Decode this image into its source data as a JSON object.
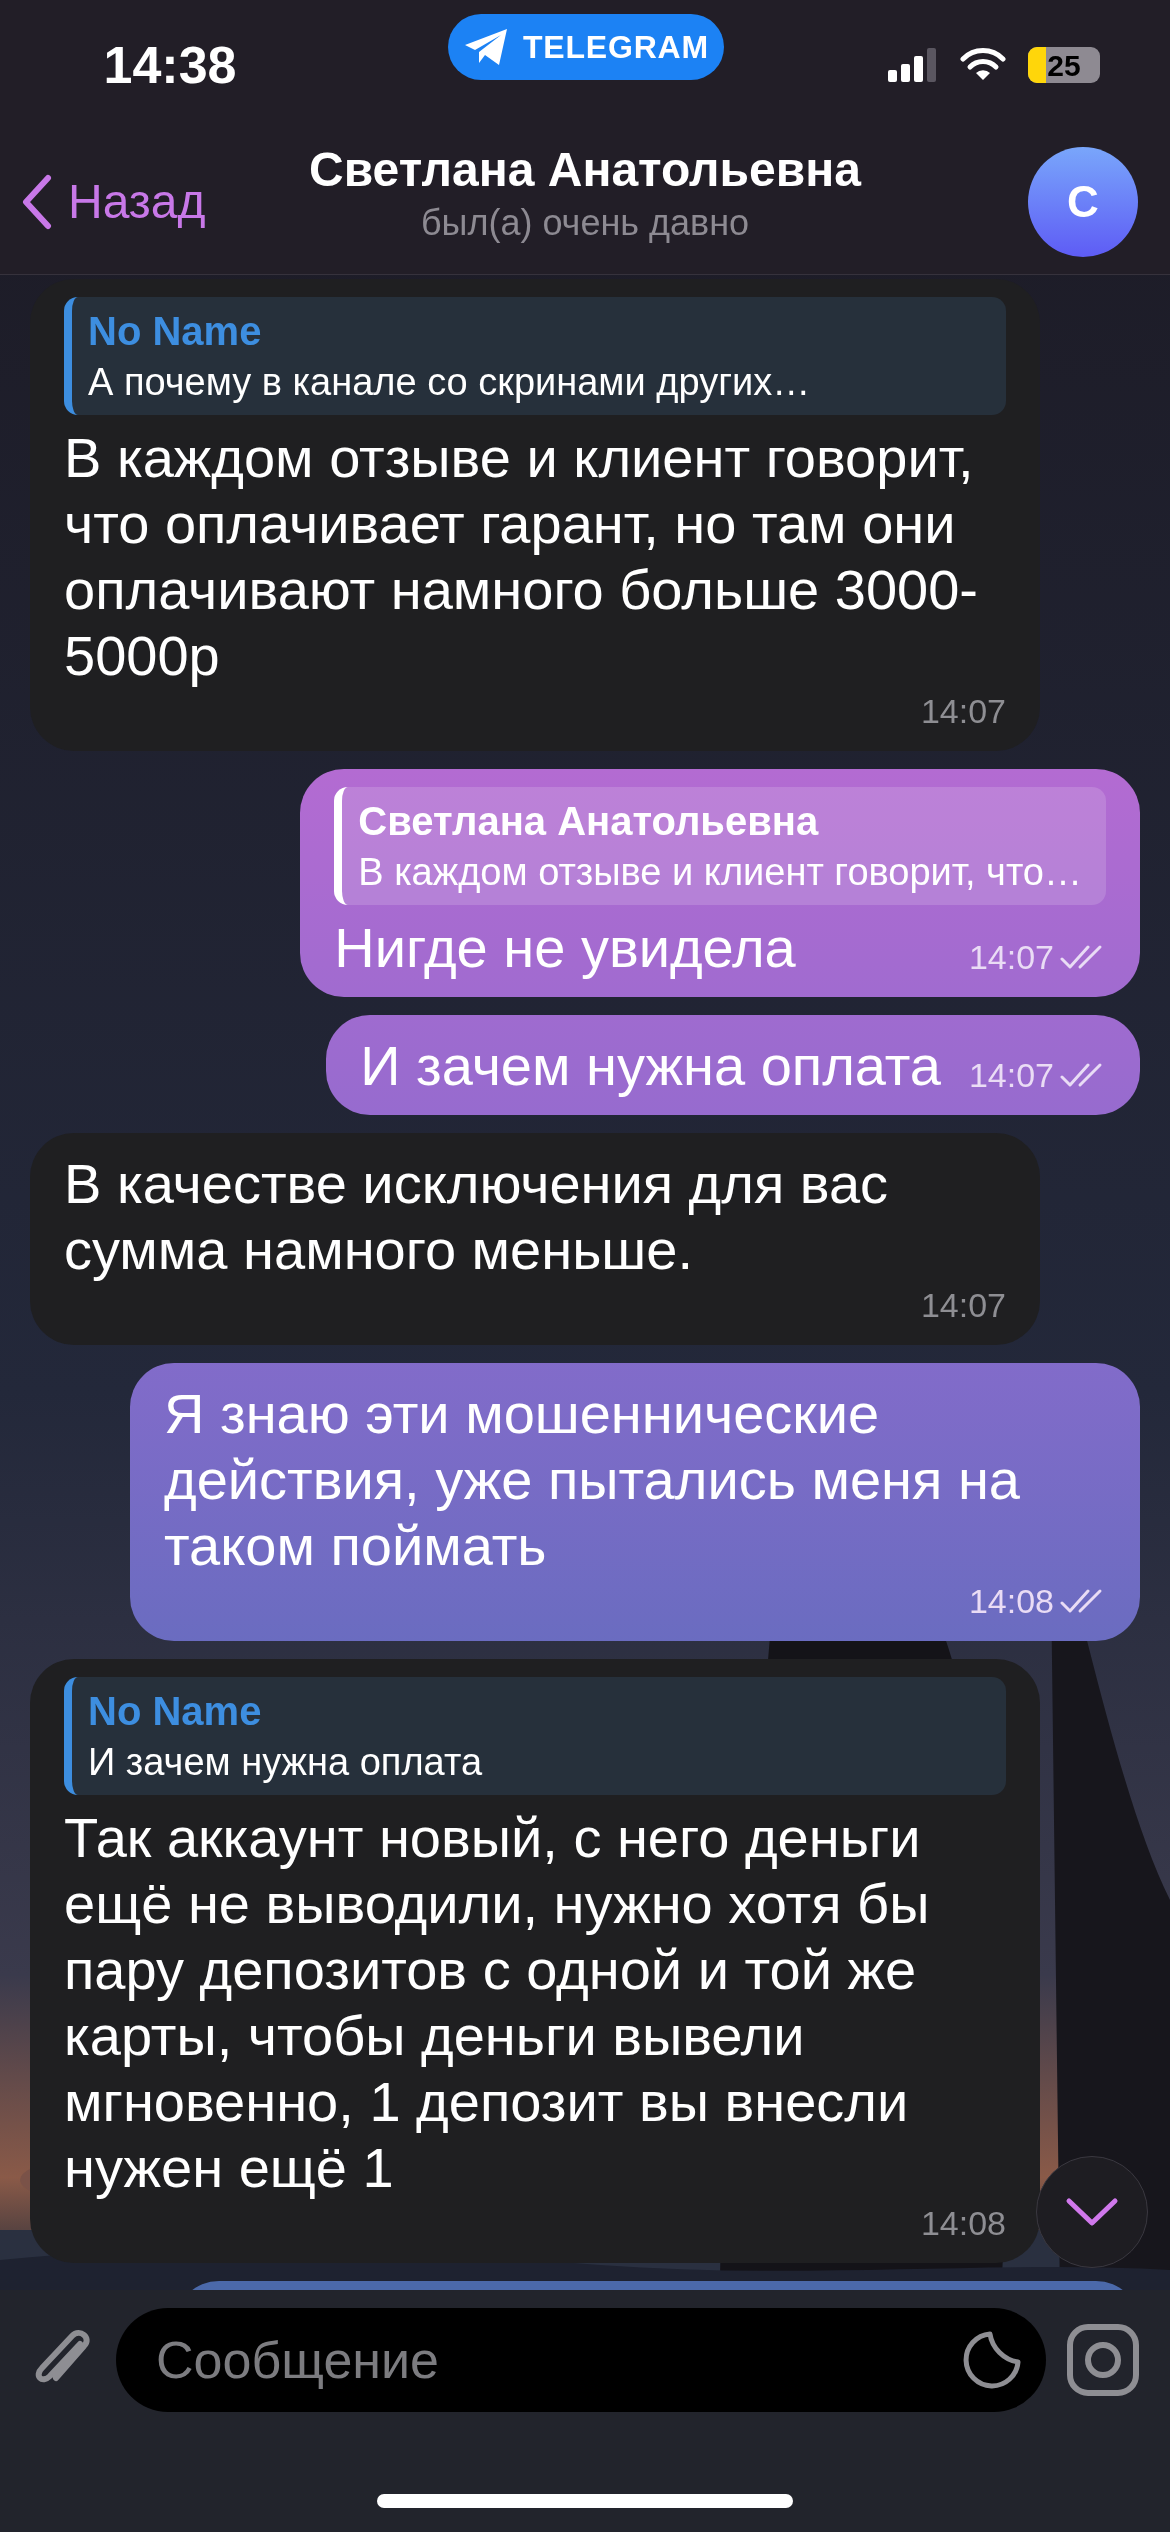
{
  "status_bar": {
    "time": "14:38",
    "app_pill": "TELEGRAM",
    "battery": "25"
  },
  "header": {
    "back": "Назад",
    "title": "Светлана Анатольевна",
    "subtitle": "был(а) очень давно",
    "avatar": "С"
  },
  "messages": [
    {
      "kind": "incoming",
      "reply": {
        "name": "No Name",
        "text": "А почему в канале со скринами других…"
      },
      "text": "В каждом отзыве и клиент говорит, что оплачивает гарант, но там они оплачивают намного больше 3000-5000р",
      "time": "14:07"
    },
    {
      "kind": "outgoing",
      "reply": {
        "name": "Светлана Анатольевна",
        "text": "В каждом отзыве и клиент говорит, что…"
      },
      "text": "Нигде не увидела",
      "time": "14:07",
      "read": true
    },
    {
      "kind": "outgoing",
      "text": "И зачем нужна оплата",
      "time": "14:07",
      "read": true
    },
    {
      "kind": "incoming",
      "text": "В качестве исключения для вас сумма намного меньше.",
      "time": "14:07"
    },
    {
      "kind": "outgoing",
      "text": "Я знаю эти мошеннические действия, уже пытались меня на таком поймать",
      "time": "14:08",
      "read": true
    },
    {
      "kind": "incoming",
      "reply": {
        "name": "No Name",
        "text": "И зачем нужна оплата"
      },
      "text": "Так аккаунт новый, с него деньги ещё не выводили, нужно хотя бы пару депозитов с одной и той же карты, чтобы деньги вывели мгновенно, 1 депозит вы внесли нужен ещё 1",
      "time": "14:08"
    },
    {
      "kind": "outgoing_partial"
    }
  ],
  "composer": {
    "placeholder": "Сообщение"
  }
}
